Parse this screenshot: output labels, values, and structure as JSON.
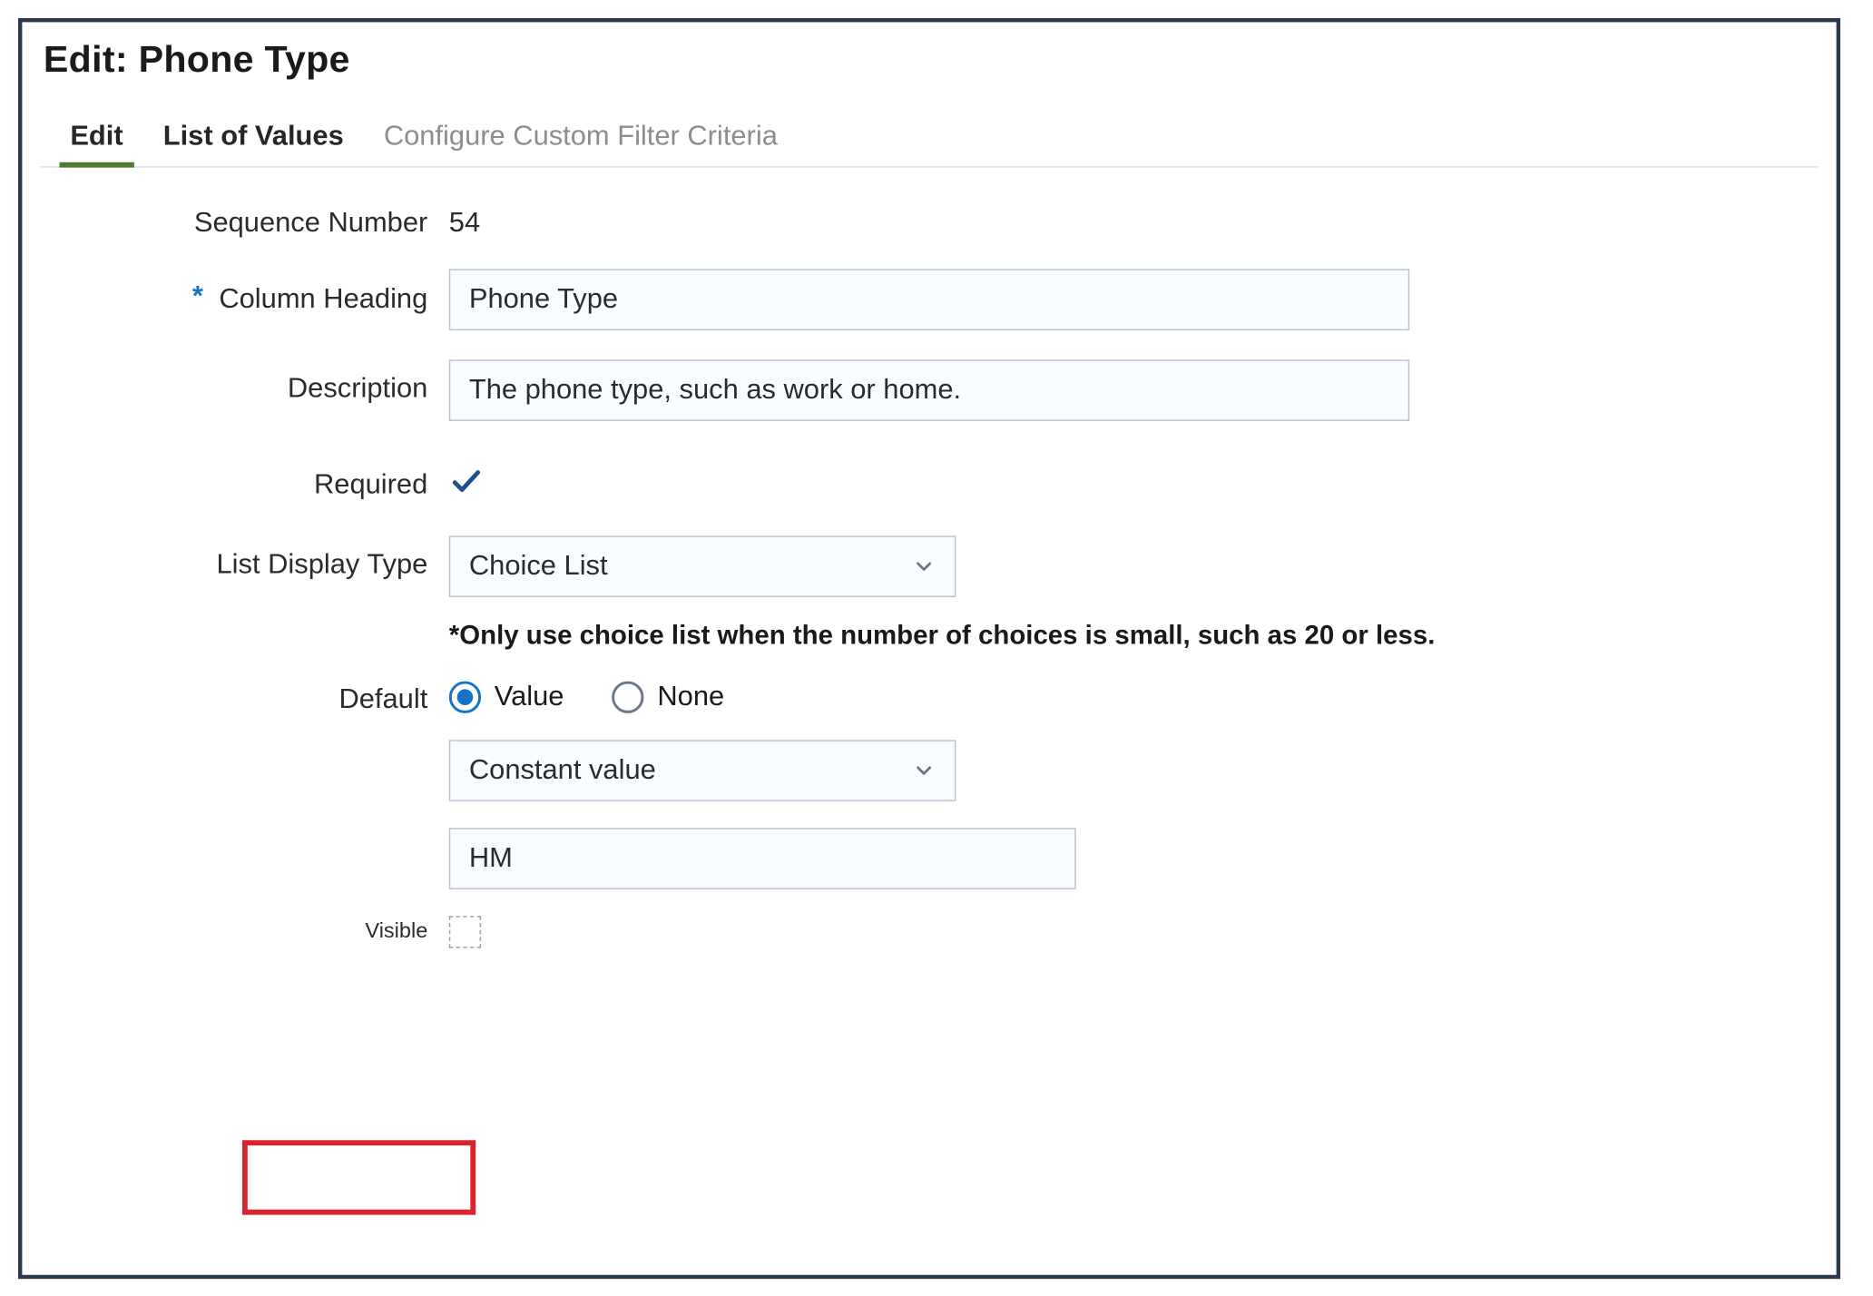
{
  "title": "Edit: Phone Type",
  "tabs": [
    {
      "label": "Edit",
      "state": "active"
    },
    {
      "label": "List of Values",
      "state": "secondary"
    },
    {
      "label": "Configure Custom Filter Criteria",
      "state": "disabled"
    }
  ],
  "form": {
    "sequence_number": {
      "label": "Sequence Number",
      "value": "54"
    },
    "column_heading": {
      "label": "Column Heading",
      "required_mark": "*",
      "value": "Phone Type"
    },
    "description": {
      "label": "Description",
      "value": "The phone type, such as work or home."
    },
    "required": {
      "label": "Required",
      "checked": true
    },
    "list_display_type": {
      "label": "List Display Type",
      "value": "Choice List",
      "note": "*Only use choice list when the number of choices is small, such as 20 or less."
    },
    "default": {
      "label": "Default",
      "options": [
        {
          "label": "Value",
          "checked": true
        },
        {
          "label": "None",
          "checked": false
        }
      ],
      "mode_value": "Constant value",
      "constant_value": "HM"
    },
    "visible": {
      "label": "Visible",
      "checked": false
    }
  }
}
